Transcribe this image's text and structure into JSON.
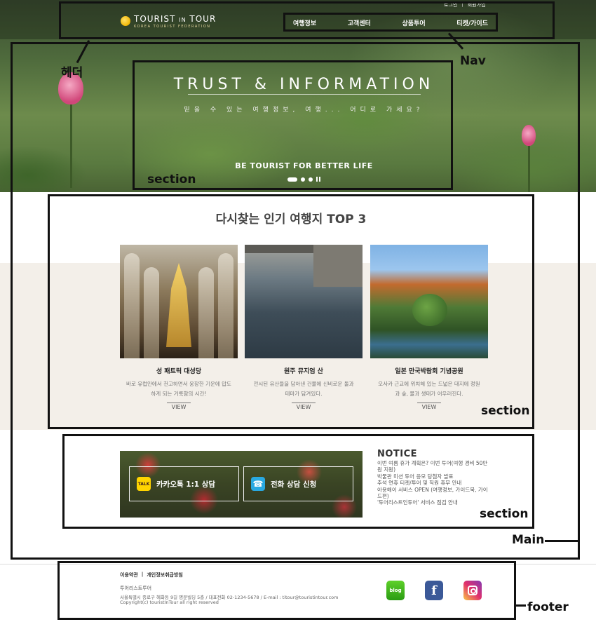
{
  "header": {
    "logo_name": "TOURIST",
    "logo_in": "IN",
    "logo_tour": "TOUR",
    "logo_tagline": "KOREA TOURIST FEDERATION",
    "util_login": "로그인",
    "util_join": "회원가입",
    "nav": [
      "여행정보",
      "고객센터",
      "상품투어",
      "티켓/가이드"
    ]
  },
  "hero": {
    "title": "TRUST & INFORMATION",
    "subtitle": "믿을 수 있는 여행정보, 여행... 어디로 가세요?",
    "tagline": "BE TOURIST FOR BETTER LIFE"
  },
  "top3": {
    "title": "다시찾는 인기 여행지 TOP 3",
    "view_label": "VIEW",
    "cards": [
      {
        "name": "성 패트릭 대성당",
        "desc": "바로 유럽안에서 천고하면서 웅장한 기운에 압도하게 되는 거룩함의 시간!"
      },
      {
        "name": "원주 뮤지엄 산",
        "desc": "전시된 유산들을 담아낸 건물에 신비로운 돌과 테마가 담겨있다."
      },
      {
        "name": "일본 만국박람회 기념공원",
        "desc": "오사카 근교에 위치해 있는 드넓은 대지에 정원과 숲, 물과 생태가 어우러진다."
      }
    ]
  },
  "consult": {
    "kakao_icon": "TALK",
    "kakao_label": "카카오톡 1:1 상담",
    "phone_label": "전화 상담 신청"
  },
  "notice": {
    "title": "NOTICE",
    "items": [
      "이번 여름 휴가 계획은? 이번 투어(여행 경비 50만원 지원)",
      "박물관 미션 투어 응모 당첨자 발표",
      "추석 연휴 티켓/투어 및 직원 휴무 안내",
      "아용해이 서비스 OPEN (여행정보, 가이드북, 가이드편)",
      "'투어리스트인투어' 서비스 점검 안내"
    ]
  },
  "footer": {
    "links": [
      "이용약관",
      "개인정보취급방침"
    ],
    "link_sep": "|",
    "company": "투어리스트투어",
    "address": "서울특별시 종로구 혜화동 9길 명문빌딩 5층 / 대표전화 02-1234-5678 / E-mail : titour@touristintour.com",
    "copyright": "Copyright(c) touristInTour all right reserved",
    "blog_label": "blog",
    "facebook_label": "f"
  },
  "annotations": {
    "header": "헤더",
    "nav": "Nav",
    "section": "section",
    "main": "Main",
    "footer": "footer"
  }
}
